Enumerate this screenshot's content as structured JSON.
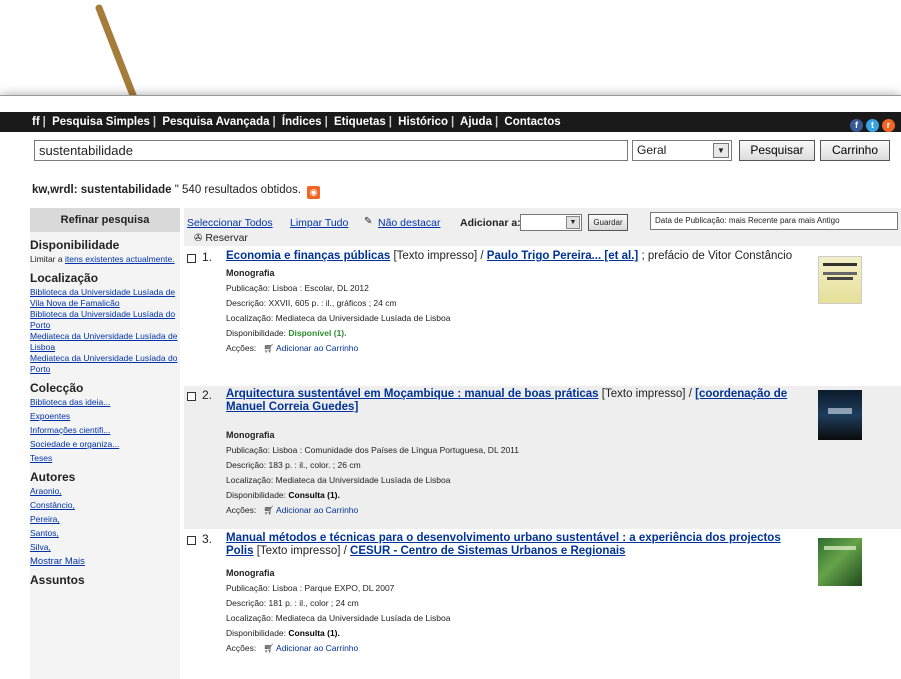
{
  "nav": {
    "items": [
      "ff",
      "Pesquisa Simples",
      "Pesquisa Avançada",
      "Índices",
      "Etiquetas",
      "Histórico",
      "Ajuda",
      "Contactos"
    ]
  },
  "search": {
    "query": "sustentabilidade",
    "type": "Geral",
    "search_button": "Pesquisar",
    "cart_button": "Carrinho"
  },
  "summary": {
    "query_label": "kw,wrdl: sustentabilidade",
    "count_text": "540 resultados obtidos."
  },
  "sidebar": {
    "refine": "Refinar pesquisa",
    "availability_heading": "Disponibilidade",
    "availability_text": "Limitar a",
    "availability_link": "itens existentes actualmente.",
    "location_heading": "Localização",
    "locations": [
      "Biblioteca da Universidade Lusíada de Vila Nova de Famalicão",
      "Biblioteca da Universidade Lusíada do Porto",
      "Mediateca da Universidade Lusíada de Lisboa",
      "Mediateca da Universidade Lusíada do Porto"
    ],
    "collection_heading": "Colecção",
    "collections": [
      "Biblioteca das ideia...",
      "Expoentes",
      "Informações cientifi...",
      "Sociedade e organiza...",
      "Teses"
    ],
    "authors_heading": "Autores",
    "authors": [
      "Araonio,",
      "Constâncio,",
      "Pereira,",
      "Santos,",
      "Silva,"
    ],
    "show_more": "Mostrar Mais",
    "subjects_heading": "Assuntos"
  },
  "toolbar": {
    "select_all": "Seleccionar Todos",
    "clear_all": "Limpar Tudo",
    "unhighlight": "Não destacar",
    "add_to": "Adicionar a:",
    "save": "Guardar",
    "sort": "Data de Publicação: mais Recente para mais Antigo",
    "reserve": "Reservar"
  },
  "labels": {
    "publication": "Publicação:",
    "description": "Descrição:",
    "location": "Localização:",
    "availability": "Disponibilidade:",
    "actions": "Acções:",
    "add_to_cart": "Adicionar ao Carrinho"
  },
  "results": [
    {
      "num": "1.",
      "title": "Economia e finanças públicas",
      "medium": "[Texto impresso] /",
      "author": "Paulo Trigo Pereira... [et al.]",
      "rest": "; prefácio de Vitor Constâncio",
      "type": "Monografia",
      "publication": "Lisboa : Escolar, DL 2012",
      "description": "XXVII, 605 p. : il., gráficos ; 24 cm",
      "location": "Mediateca da Universidade Lusíada de Lisboa",
      "availability": "Disponível (1)."
    },
    {
      "num": "2.",
      "title": "Arquitectura sustentável em Moçambique : manual de boas práticas",
      "medium": "[Texto impresso] /",
      "author": "[coordenação de Manuel Correia Guedes]",
      "rest": "",
      "type": "Monografia",
      "publication": "Lisboa : Comunidade dos Países de Língua Portuguesa, DL 2011",
      "description": "183 p. : il., color. ; 26 cm",
      "location": "Mediateca da Universidade Lusíada de Lisboa",
      "availability": "Consulta (1)."
    },
    {
      "num": "3.",
      "title": "Manual métodos e técnicas para o desenvolvimento urbano sustentável : a experiência dos projectos Polis",
      "medium": "[Texto impresso] /",
      "author": "CESUR - Centro de Sistemas Urbanos e Regionais",
      "rest": "",
      "type": "Monografia",
      "publication": "Lisboa : Parque EXPO, DL 2007",
      "description": "181 p. : il., color ; 24 cm",
      "location": "Mediateca da Universidade Lusíada de Lisboa",
      "availability": "Consulta (1)."
    }
  ],
  "colors": {
    "link": "#0033aa",
    "nav_bg": "#1a1a1a",
    "available": "#2e8b2e",
    "arrow": "#a67c3a"
  }
}
